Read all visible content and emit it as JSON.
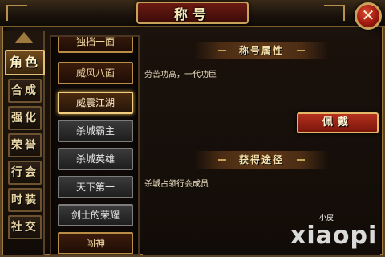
{
  "window": {
    "title": "称号",
    "close_glyph": "✕"
  },
  "left_nav": {
    "tabs": [
      {
        "label": "角色",
        "active": true
      },
      {
        "label": "合成",
        "active": false
      },
      {
        "label": "强化",
        "active": false
      },
      {
        "label": "荣誉",
        "active": false
      },
      {
        "label": "行会",
        "active": false
      },
      {
        "label": "时装",
        "active": false
      },
      {
        "label": "社交",
        "active": false
      }
    ]
  },
  "title_list": {
    "items": [
      {
        "label": "独挡一面",
        "style": "gold"
      },
      {
        "label": "威风八面",
        "style": "gold"
      },
      {
        "label": "威震江湖",
        "style": "selected"
      },
      {
        "label": "杀城霸主",
        "style": "gray"
      },
      {
        "label": "杀城英雄",
        "style": "gray"
      },
      {
        "label": "天下第一",
        "style": "gray"
      },
      {
        "label": "剑士的荣耀",
        "style": "gray"
      },
      {
        "label": "闯神",
        "style": "gold"
      }
    ]
  },
  "detail": {
    "attr_header": "称号属性",
    "attr_text": "劳苦功高，一代功臣",
    "wear_button": "佩戴",
    "source_header": "获得途径",
    "source_text": "杀城占领行会成员"
  },
  "watermark": {
    "small": "小皮",
    "big": "xiaopi"
  },
  "colors": {
    "accent_gold": "#c9a25a",
    "button_red": "#b5321f"
  }
}
